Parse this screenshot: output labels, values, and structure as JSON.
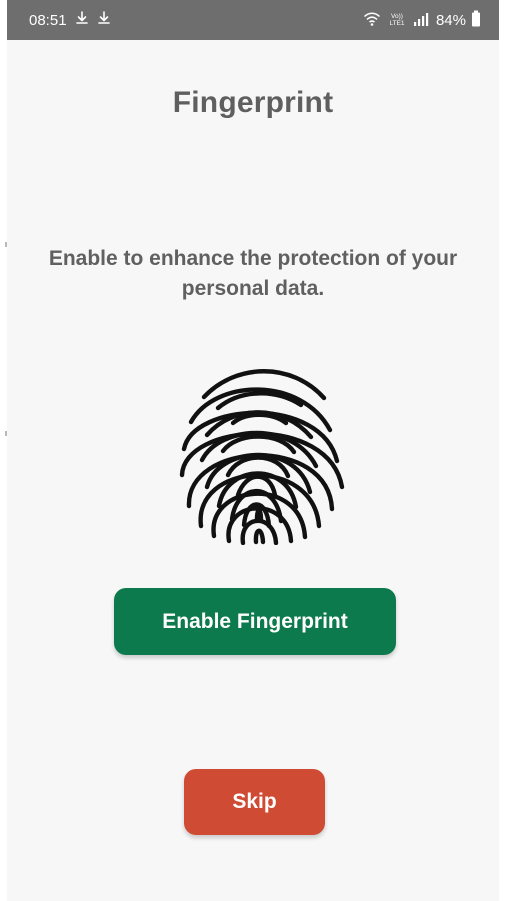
{
  "status_bar": {
    "time": "08:51",
    "left_icons": [
      "download-icon",
      "download-icon"
    ],
    "volte_label": "Vo))\nLTE1",
    "signal_icon": "signal-icon",
    "battery": "84%"
  },
  "screen": {
    "title": "Fingerprint",
    "description": "Enable to enhance the protection of your personal data.",
    "fingerprint_icon": "fingerprint-icon"
  },
  "actions": {
    "enable_label": "Enable Fingerprint",
    "skip_label": "Skip"
  },
  "colors": {
    "status_bar": "#6e6e6e",
    "background": "#f7f7f7",
    "title_text": "#5f5f5f",
    "enable_button": "#0d7a4e",
    "skip_button": "#cf4b33"
  }
}
